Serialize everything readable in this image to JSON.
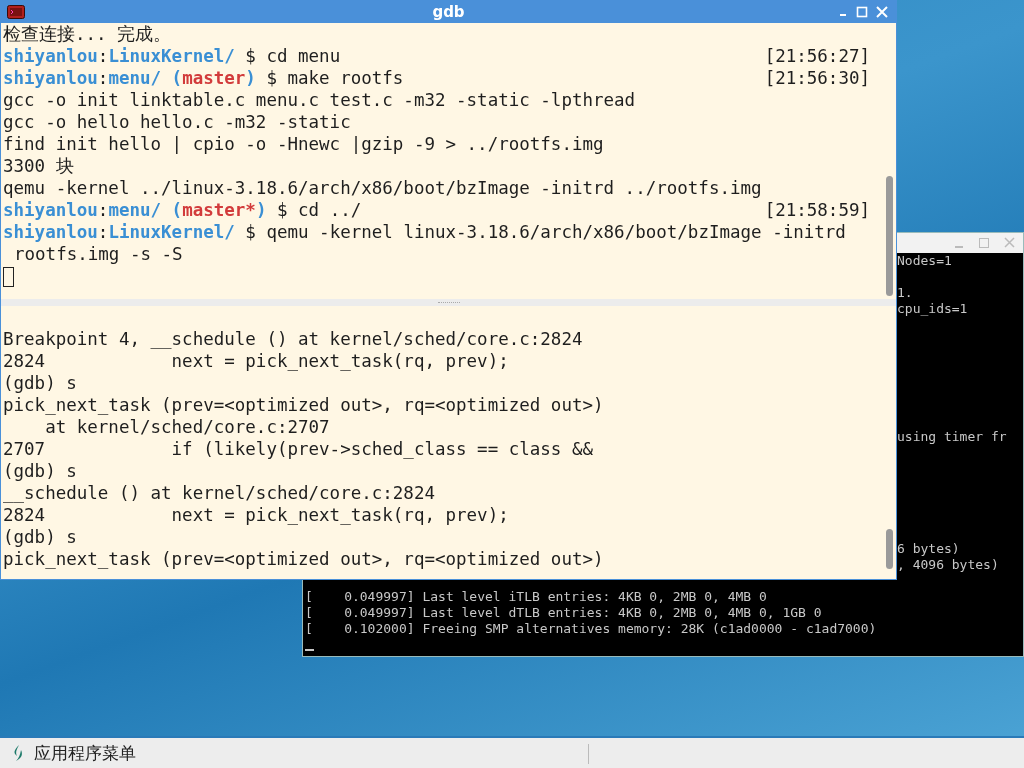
{
  "gdb_window": {
    "title": "gdb",
    "terminal": [
      {
        "kind": "output",
        "text": "检查连接... 完成。"
      },
      {
        "kind": "prompt",
        "host": "shiyanlou",
        "sep": ":",
        "dir": "LinuxKernel/",
        "symbol": "$",
        "command": "cd menu",
        "time": "[21:56:27]"
      },
      {
        "kind": "prompt",
        "host": "shiyanlou",
        "sep": ":",
        "dir": "menu/",
        "branch": {
          "open": "(",
          "name": "master",
          "close": ")"
        },
        "symbol": "$",
        "command": "make rootfs",
        "time": "[21:56:30]"
      },
      {
        "kind": "output",
        "text": "gcc -o init linktable.c menu.c test.c -m32 -static -lpthread"
      },
      {
        "kind": "output",
        "text": "gcc -o hello hello.c -m32 -static"
      },
      {
        "kind": "output",
        "text": "find init hello | cpio -o -Hnewc |gzip -9 > ../rootfs.img"
      },
      {
        "kind": "output",
        "text": "3300 块"
      },
      {
        "kind": "output",
        "text": "qemu -kernel ../linux-3.18.6/arch/x86/boot/bzImage -initrd ../rootfs.img"
      },
      {
        "kind": "prompt",
        "host": "shiyanlou",
        "sep": ":",
        "dir": "menu/",
        "branch": {
          "open": "(",
          "name": "master*",
          "close": ")"
        },
        "symbol": "$",
        "command": "cd ../",
        "time": "[21:58:59]"
      },
      {
        "kind": "prompt",
        "host": "shiyanlou",
        "sep": ":",
        "dir": "LinuxKernel/",
        "symbol": "$",
        "command": "qemu -kernel linux-3.18.6/arch/x86/boot/bzImage -initrd"
      },
      {
        "kind": "continuation",
        "text": "rootfs.img -s -S"
      },
      {
        "kind": "cursor"
      }
    ],
    "debugger": [
      "Breakpoint 4, __schedule () at kernel/sched/core.c:2824",
      "2824            next = pick_next_task(rq, prev);",
      "(gdb) s",
      "pick_next_task (prev=<optimized out>, rq=<optimized out>)",
      "    at kernel/sched/core.c:2707",
      "2707            if (likely(prev->sched_class == class &&",
      "(gdb) s",
      "__schedule () at kernel/sched/core.c:2824",
      "2824            next = pick_next_task(rq, prev);",
      "(gdb) s",
      "pick_next_task (prev=<optimized out>, rq=<optimized out>)"
    ]
  },
  "qemu_window": {
    "right_fragments": [
      "Nodes=1",
      "1.",
      "cpu_ids=1",
      "using timer fr",
      "6 bytes)",
      ", 4096 bytes)"
    ],
    "bottom_lines": [
      "[    0.049997] Last level iTLB entries: 4KB 0, 2MB 0, 4MB 0",
      "[    0.049997] Last level dTLB entries: 4KB 0, 2MB 0, 4MB 0, 1GB 0",
      "[    0.102000] Freeing SMP alternatives memory: 28K (c1ad0000 - c1ad7000)"
    ]
  },
  "taskbar": {
    "menu_label": "应用程序菜单"
  }
}
